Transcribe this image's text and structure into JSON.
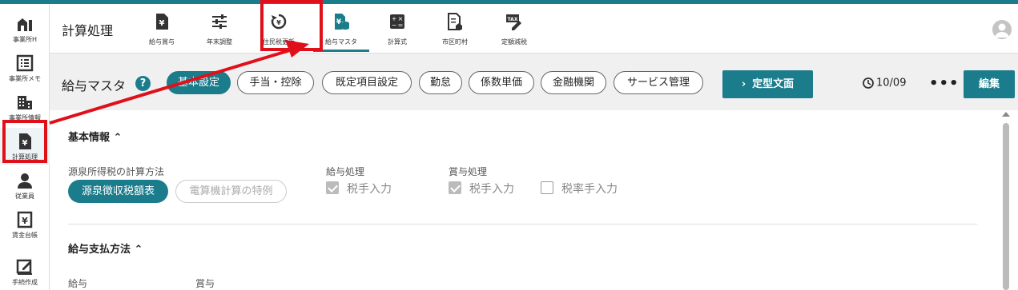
{
  "sidebar": {
    "items": [
      {
        "label": "事業所H",
        "icon": "office-building-icon"
      },
      {
        "label": "事業所メモ",
        "icon": "memo-list-icon"
      },
      {
        "label": "事業所情報",
        "icon": "building-info-icon"
      },
      {
        "label": "計算処理",
        "icon": "yen-document-icon"
      },
      {
        "label": "従業員",
        "icon": "person-icon"
      },
      {
        "label": "賃金台帳",
        "icon": "yen-ledger-icon"
      },
      {
        "label": "手続作成",
        "icon": "edit-form-icon"
      }
    ]
  },
  "header": {
    "title": "計算処理",
    "tabs": [
      {
        "label": "給与賞与",
        "icon": "yen-document-icon"
      },
      {
        "label": "年末調整",
        "icon": "sliders-icon"
      },
      {
        "label": "住民税更新",
        "icon": "refresh-icon"
      },
      {
        "label": "給与マスタ",
        "icon": "yen-db-icon"
      },
      {
        "label": "計算式",
        "icon": "calculator-icon"
      },
      {
        "label": "市区町村",
        "icon": "city-doc-icon"
      },
      {
        "label": "定額減税",
        "icon": "tax-edit-icon"
      }
    ]
  },
  "toolbar": {
    "title": "給与マスタ",
    "help": "?",
    "pills": [
      "基本設定",
      "手当・控除",
      "既定項目設定",
      "勤怠",
      "係数単価",
      "金融機関",
      "サービス管理"
    ],
    "template_button": "定型文面",
    "history_date": "10/09",
    "more": "•••",
    "edit_button": "編集"
  },
  "basic_info": {
    "heading": "基本情報",
    "withholding_label": "源泉所得税の計算方法",
    "withholding_options": [
      "源泉徴収税額表",
      "電算機計算の特例"
    ],
    "salary_label": "給与処理",
    "salary_checkbox": "税手入力",
    "bonus_label": "賞与処理",
    "bonus_checkbox": "税手入力",
    "bonus_rate_checkbox": "税率手入力"
  },
  "payment": {
    "heading": "給与支払方法",
    "salary_label": "給与",
    "bonus_label": "賞与"
  },
  "colors": {
    "accent": "#1b7c8c",
    "highlight": "#e0101a"
  }
}
